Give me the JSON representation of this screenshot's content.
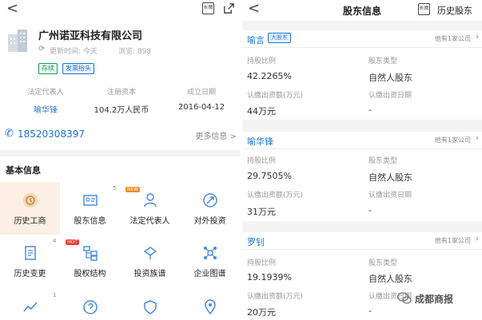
{
  "left": {
    "header": {
      "back": "<",
      "doc_icon_label": "长图"
    },
    "company": {
      "name": "广州诺亚科技有限公司",
      "update_time": "更新时间: 今天",
      "views": "浏览: 898",
      "tags": [
        "存续",
        "发票抬头"
      ]
    },
    "info": [
      {
        "label": "法定代表人",
        "value": "喻华锋"
      },
      {
        "label": "注册资本",
        "value": "104.2万人民币"
      },
      {
        "label": "成立日期",
        "value": "2016-04-12"
      }
    ],
    "phone": "18520308397",
    "more_info": "更多信息 >",
    "section_title": "基本信息",
    "grid": [
      {
        "label": "历史工商",
        "icon": "history-icon",
        "badge": ""
      },
      {
        "label": "股东信息",
        "icon": "shareholder-icon",
        "badge": "5"
      },
      {
        "label": "法定代表人",
        "icon": "person-icon",
        "badge": "NEW"
      },
      {
        "label": "对外投资",
        "icon": "investment-icon",
        "badge": ""
      },
      {
        "label": "历史变更",
        "icon": "change-icon",
        "badge": "4"
      },
      {
        "label": "股权结构",
        "icon": "structure-icon",
        "badge": "HOT"
      },
      {
        "label": "投资族谱",
        "icon": "family-tree-icon",
        "badge": ""
      },
      {
        "label": "企业图谱",
        "icon": "graph-icon",
        "badge": ""
      },
      {
        "label": "",
        "icon": "trend-icon",
        "badge": "1"
      },
      {
        "label": "",
        "icon": "question-icon",
        "badge": ""
      },
      {
        "label": "",
        "icon": "shield-icon",
        "badge": ""
      },
      {
        "label": "",
        "icon": "location-icon",
        "badge": ""
      }
    ]
  },
  "right": {
    "header": {
      "back": "<",
      "title": "股东信息",
      "history_icon_label": "长图",
      "history": "历史股东"
    },
    "labels": {
      "ratio": "持股比例",
      "type": "股东类型",
      "amount": "认缴出资额(万元)",
      "date": "认缴出资日期"
    },
    "holders": [
      {
        "name": "喻言",
        "tag": "大股东",
        "other": "他有1家公司",
        "ratio": "42.2265%",
        "type": "自然人股东",
        "amount": "44万元",
        "date": "-"
      },
      {
        "name": "喻华锋",
        "tag": "",
        "other": "他有1家公司",
        "ratio": "29.7505%",
        "type": "自然人股东",
        "amount": "31万元",
        "date": "-"
      },
      {
        "name": "罗钊",
        "tag": "",
        "other": "他有1家公司",
        "ratio": "19.1939%",
        "type": "自然人股东",
        "amount": "20万元",
        "date": "-"
      }
    ],
    "watermark": "成都商报"
  },
  "colors": {
    "accent": "#1a73d9",
    "active_bg": "#fbf0e3",
    "green": "#1e9a59",
    "hot": "#e4392b"
  }
}
